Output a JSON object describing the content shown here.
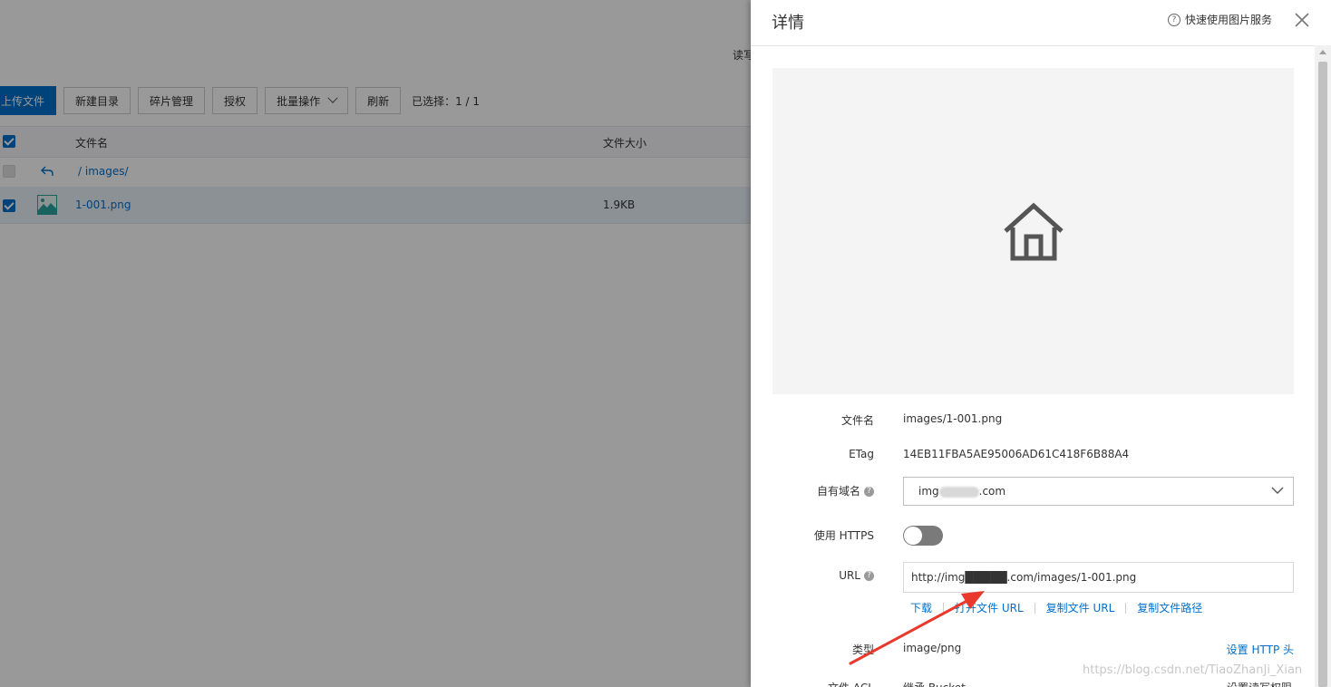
{
  "background": {
    "read_label": "读写",
    "toolbar": {
      "upload": "上传文件",
      "new_dir": "新建目录",
      "fragments": "碎片管理",
      "authorize": "授权",
      "batch": "批量操作",
      "refresh": "刷新",
      "selected": "已选择：1 / 1"
    },
    "table": {
      "col_name": "文件名",
      "col_size": "文件大小",
      "parent_path": "/ images/",
      "file_name": "1-001.png",
      "file_size": "1.9KB"
    }
  },
  "panel": {
    "title": "详情",
    "help_link": "快速使用图片服务",
    "fields": {
      "filename_label": "文件名",
      "filename_value": "images/1-001.png",
      "etag_label": "ETag",
      "etag_value": "14EB11FBA5AE95006AD61C418F6B88A4",
      "domain_label": "自有域名",
      "domain_prefix": "img",
      "domain_suffix": ".com",
      "https_label": "使用 HTTPS",
      "https_enabled": false,
      "url_label": "URL",
      "url_value": "http://img█████.com/images/1-001.png",
      "type_label": "类型",
      "type_value": "image/png",
      "http_header_link": "设置 HTTP 头"
    },
    "actions": {
      "download": "下载",
      "open_url": "打开文件 URL",
      "copy_url": "复制文件 URL",
      "copy_path": "复制文件路径"
    },
    "cutoff_left": "文件 ACL",
    "cutoff_mid": "继承 Bucket",
    "cutoff_right": "设置读写权限"
  },
  "watermark": "https://blog.csdn.net/TiaoZhanJi_Xian",
  "colors": {
    "accent": "#0070cc",
    "overlay": "rgba(0,0,0,0.4)",
    "annotation_arrow": "#e8392c"
  }
}
